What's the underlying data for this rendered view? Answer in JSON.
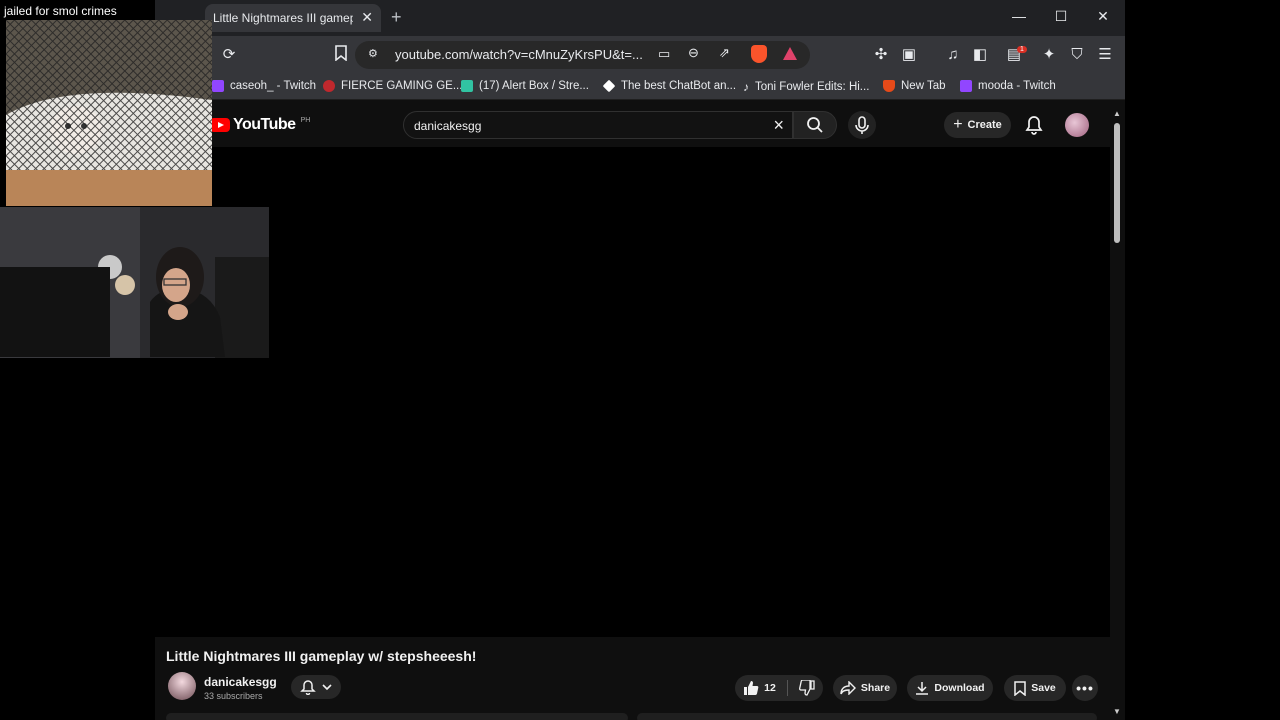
{
  "overlay": {
    "caption": "jailed for smol crimes"
  },
  "browser": {
    "tab_title": "Little Nightmares III gameplay w/ stepsheeesh!",
    "tab_close": "✕",
    "new_tab": "+",
    "window_controls": {
      "minimize": "—",
      "maximize": "☐",
      "close": "✕"
    },
    "url": "youtube.com/watch?v=cMnuZyKrsPU&t=...",
    "notification_count": "1",
    "bookmarks": [
      {
        "label": "caseoh_ - Twitch",
        "color": "#9146ff"
      },
      {
        "label": "FIERCE GAMING GE...",
        "color": "#c0282d"
      },
      {
        "label": "(17) Alert Box / Stre...",
        "color": "#31c3a2"
      },
      {
        "label": "The best ChatBot an...",
        "color": "#ffffff"
      },
      {
        "label": "Toni Fowler Edits: Hi...",
        "color": "#000000"
      },
      {
        "label": "New Tab",
        "color": "#e64a19"
      },
      {
        "label": "mooda - Twitch",
        "color": "#9146ff"
      }
    ]
  },
  "youtube": {
    "logo_text": "YouTube",
    "country_code": "PH",
    "search_value": "danicakesgg",
    "create_label": "Create",
    "video": {
      "title": "Little Nightmares III gameplay w/ stepsheeesh!",
      "channel": "danicakesgg",
      "subscribers": "33 subscribers",
      "likes": "12",
      "share_label": "Share",
      "download_label": "Download",
      "save_label": "Save"
    }
  },
  "colors": {
    "accent": "#ff0000",
    "background": "#0f0f0f",
    "chrome": "#35363a"
  }
}
